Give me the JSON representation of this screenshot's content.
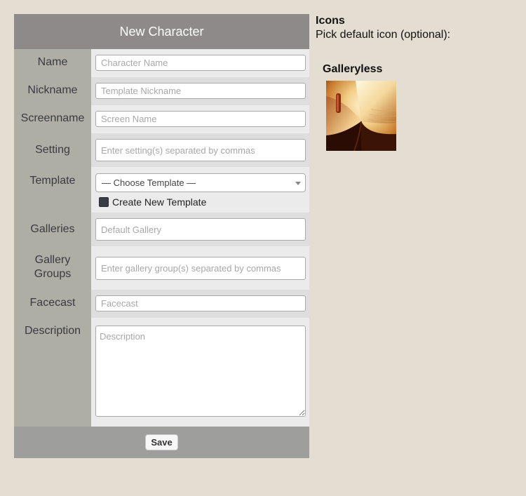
{
  "form": {
    "title": "New Character",
    "fields": {
      "name": {
        "label": "Name",
        "placeholder": "Character Name",
        "value": ""
      },
      "nickname": {
        "label": "Nickname",
        "placeholder": "Template Nickname",
        "value": ""
      },
      "screenname": {
        "label": "Screenname",
        "placeholder": "Screen Name",
        "value": ""
      },
      "setting": {
        "label": "Setting",
        "placeholder": "Enter setting(s) separated by commas",
        "value": ""
      },
      "template": {
        "label": "Template",
        "selected": "— Choose Template —",
        "checkbox_label": "Create New Template"
      },
      "galleries": {
        "label": "Galleries",
        "placeholder": "Default Gallery",
        "value": ""
      },
      "gallery_groups": {
        "label_line1": "Gallery",
        "label_line2": "Groups",
        "placeholder": "Enter gallery group(s) separated by commas",
        "value": ""
      },
      "facecast": {
        "label": "Facecast",
        "placeholder": "Facecast",
        "value": ""
      },
      "description": {
        "label": "Description",
        "placeholder": "Description",
        "value": ""
      }
    },
    "save_label": "Save"
  },
  "icons": {
    "title": "Icons",
    "subtitle": "Pick default icon (optional):",
    "gallery_name": "Galleryless",
    "thumbnail_icon": "open-book-icon"
  },
  "colors": {
    "page_background": "#e4ded2",
    "header_background": "#8e8a8a",
    "label_column": "#aeaea4",
    "footer_background": "#9e9e9c"
  }
}
